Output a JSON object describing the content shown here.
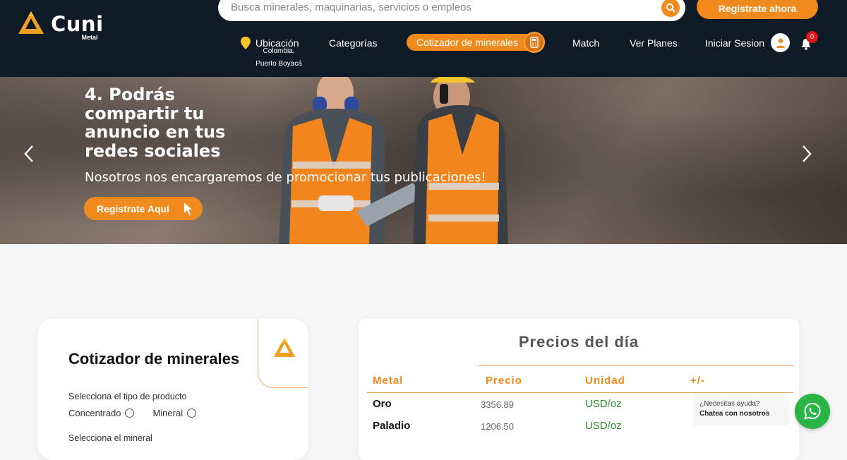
{
  "brand": {
    "name": "Cuni",
    "sub": "Metal"
  },
  "search": {
    "placeholder": "Busca minerales, maquinarias, servicios o empleos"
  },
  "header": {
    "register_label": "Registrate ahora"
  },
  "nav": {
    "location_label": "Ubicación",
    "location_detail": "Colombia, Puerto Boyacá",
    "categories": "Categorías",
    "cotizador": "Cotizador de minerales",
    "match": "Match",
    "plans": "Ver Planes",
    "login": "Iniciar Sesion",
    "notifications": "0"
  },
  "hero": {
    "title": "4. Podrás compartir tu anuncio en tus redes sociales",
    "subtitle": "Nosotros nos encargaremos de promocionar tus publicaciones!",
    "cta": "Registrate Aquí"
  },
  "cotizador": {
    "title": "Cotizador de minerales",
    "product_label": "Selecciona el tipo de producto",
    "options": [
      "Concentrado",
      "Mineral"
    ],
    "mineral_label": "Selecciona el mineral"
  },
  "prices": {
    "title": "Precios del día",
    "headers": [
      "Metal",
      "Precio",
      "Unidad",
      "+/-"
    ],
    "rows": [
      {
        "metal": "Oro",
        "price": "3356.89",
        "unit": "USD/oz",
        "change": ""
      },
      {
        "metal": "Paladio",
        "price": "1206.50",
        "unit": "USD/oz",
        "change": ""
      }
    ]
  },
  "help": {
    "question": "¿Necesitas ayuda?",
    "cta": "Chatea con nosotros"
  },
  "colors": {
    "accent": "#f08a1c",
    "header_bg": "#0f1a27",
    "price_unit": "#2e8b2e",
    "whatsapp": "#2ab446"
  }
}
